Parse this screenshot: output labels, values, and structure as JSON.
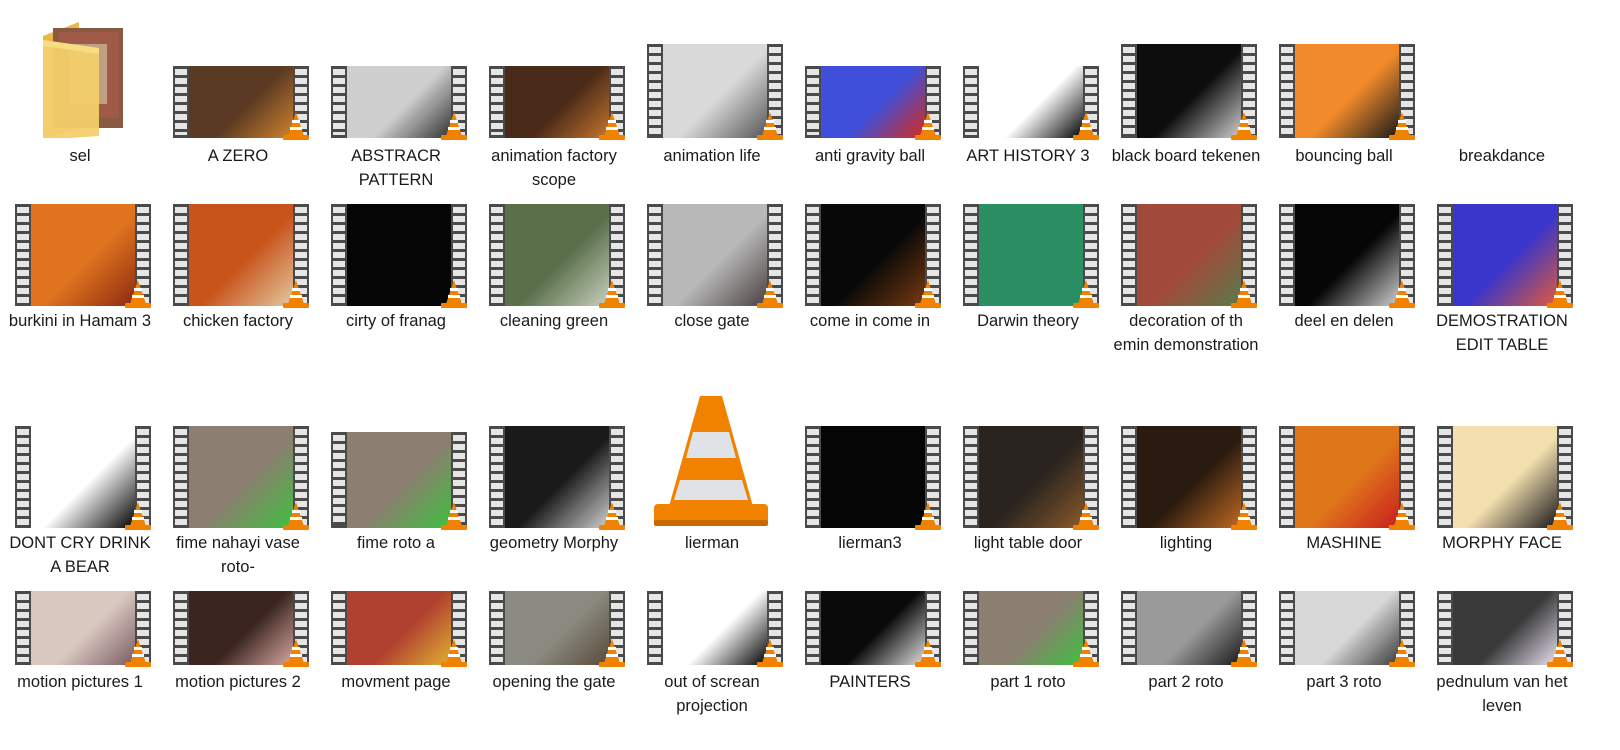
{
  "folder": {
    "label": "sel"
  },
  "items": [
    {
      "label": "A ZERO",
      "bg": "#5a3a22",
      "accent": "#d2822f"
    },
    {
      "label": "ABSTRACR PATTERN",
      "bg": "#cfcfcf",
      "accent": "#333333"
    },
    {
      "label": "animation factory scope",
      "bg": "#4a2a18",
      "accent": "#c8762e"
    },
    {
      "label": "animation life",
      "bg": "#d9d9d9",
      "accent": "#555555"
    },
    {
      "label": "anti gravity ball",
      "bg": "#3f4fd9",
      "accent": "#d82a1c"
    },
    {
      "label": "ART HISTORY 3",
      "bg": "#ffffff",
      "accent": "#000000"
    },
    {
      "label": "black board tekenen",
      "bg": "#0d0d0d",
      "accent": "#cfcfcf"
    },
    {
      "label": "bouncing ball",
      "bg": "#f08a2a",
      "accent": "#1a1a1a"
    },
    {
      "label": "breakdance",
      "bg": "#3a36c9",
      "accent": "#e05a3a"
    },
    {
      "label": "burkini in Hamam 3",
      "bg": "#e0731f",
      "accent": "#8a2a10"
    },
    {
      "label": "chicken factory",
      "bg": "#c8541c",
      "accent": "#e3c9a0"
    },
    {
      "label": "cirty of franag",
      "bg": "#050505",
      "accent": "#050505"
    },
    {
      "label": "cleaning green",
      "bg": "#5a6f4a",
      "accent": "#c8d0c0"
    },
    {
      "label": "close gate",
      "bg": "#b8b8b8",
      "accent": "#4a4040"
    },
    {
      "label": "come in come in",
      "bg": "#080808",
      "accent": "#7a3a10"
    },
    {
      "label": "Darwin theory",
      "bg": "#2a8f62",
      "accent": "#2a8f62"
    },
    {
      "label": "decoration of th emin demonstration",
      "bg": "#a24a3a",
      "accent": "#5a7a4a"
    },
    {
      "label": "deel en delen",
      "bg": "#050505",
      "accent": "#d0d0d0"
    },
    {
      "label": "DEMOSTRATION EDIT TABLE",
      "bg": "#8a8a8a",
      "accent": "#d2a890"
    },
    {
      "label": "DONT CRY DRINK A BEAR",
      "bg": "#ffffff",
      "accent": "#000000"
    },
    {
      "label": "fime nahayi vase roto-",
      "bg": "#8a7f70",
      "accent": "#3fbf3f"
    },
    {
      "label": "fime roto a",
      "bg": "#8a7f70",
      "accent": "#3fbf3f"
    },
    {
      "label": "geometry Morphy",
      "bg": "#1a1a1a",
      "accent": "#cfcfcf"
    },
    {
      "label": "lierman",
      "bg": "#ffffff",
      "accent": "#f08200"
    },
    {
      "label": "lierman3",
      "bg": "#050505",
      "accent": "#050505"
    },
    {
      "label": "light table door",
      "bg": "#2a2420",
      "accent": "#8a5a2a"
    },
    {
      "label": "lighting",
      "bg": "#2a1a10",
      "accent": "#c06a22"
    },
    {
      "label": "MASHINE",
      "bg": "#e0761a",
      "accent": "#c81e1e"
    },
    {
      "label": "MORPHY FACE",
      "bg": "#f3dfb0",
      "accent": "#1a1a1a"
    },
    {
      "label": "motion pictures 1",
      "bg": "#d8c8c0",
      "accent": "#7a5a60"
    },
    {
      "label": "motion pictures 2",
      "bg": "#3a2420",
      "accent": "#d8a8a0"
    },
    {
      "label": "movment page",
      "bg": "#b04030",
      "accent": "#e0b030"
    },
    {
      "label": "opening the gate",
      "bg": "#8a8a80",
      "accent": "#5a4a3a"
    },
    {
      "label": "out of screan projection",
      "bg": "#ffffff",
      "accent": "#000000"
    },
    {
      "label": "PAINTERS",
      "bg": "#0a0a0a",
      "accent": "#e0e0e0"
    },
    {
      "label": "part 1 roto",
      "bg": "#8a7f70",
      "accent": "#3fbf3f"
    },
    {
      "label": "part 2 roto",
      "bg": "#9a9a9a",
      "accent": "#1a1a1a"
    },
    {
      "label": "part 3 roto",
      "bg": "#d8d8d8",
      "accent": "#3a3a3a"
    },
    {
      "label": "pednulum van het leven",
      "bg": "#3a3a3a",
      "accent": "#e8e0f0"
    }
  ]
}
